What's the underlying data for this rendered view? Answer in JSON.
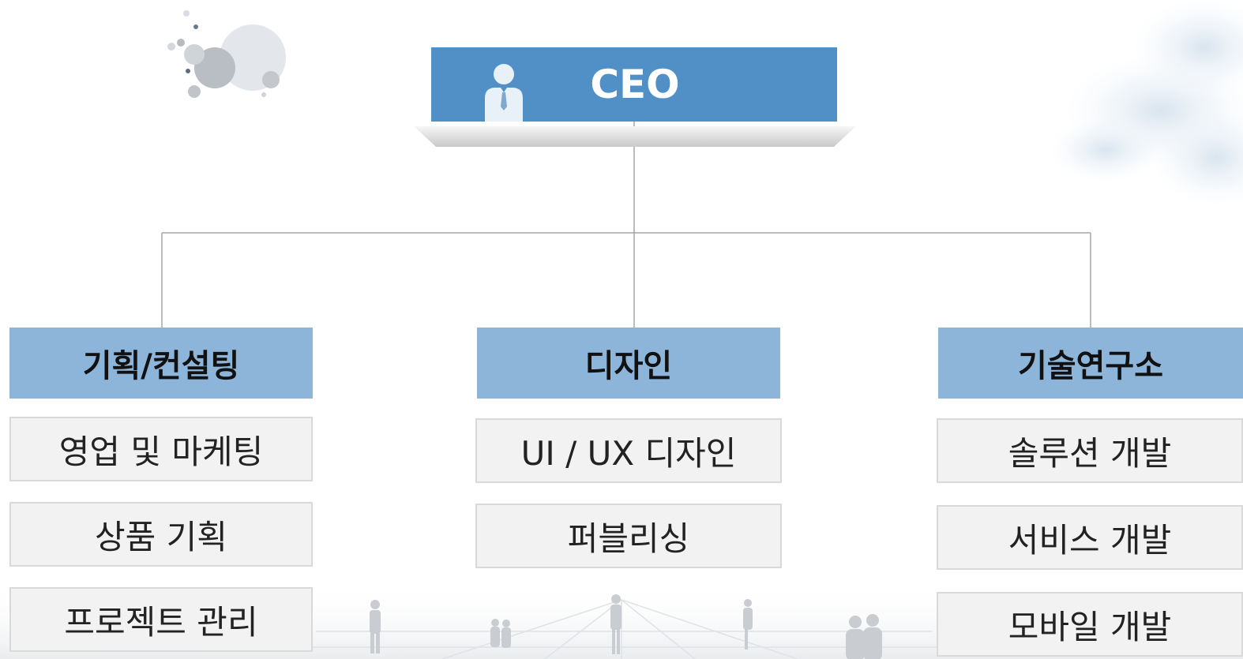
{
  "chart": {
    "ceo": {
      "label": "CEO"
    },
    "departments": [
      {
        "name": "기획/컨설팅",
        "items": [
          "영업 및 마케팅",
          "상품 기획",
          "프로젝트 관리"
        ]
      },
      {
        "name": "디자인",
        "items": [
          "UI / UX 디자인",
          "퍼블리싱"
        ]
      },
      {
        "name": "기술연구소",
        "items": [
          "솔루션 개발",
          "서비스 개발",
          "모바일 개발"
        ]
      }
    ]
  },
  "colors": {
    "ceo_box": "#5190c6",
    "department_header": "#8db5d9",
    "item_box": "#f2f2f2",
    "item_border": "#d9d9d9",
    "connector_line": "#a6a6a6"
  },
  "icons": [
    "person-icon",
    "bubble-decoration",
    "cloud-decoration",
    "silhouette-decoration"
  ]
}
